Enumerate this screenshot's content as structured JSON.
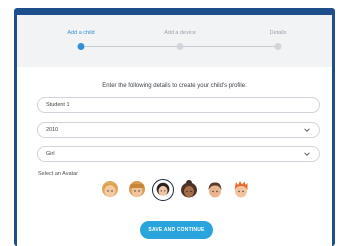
{
  "steps": [
    {
      "label": "Add a child",
      "active": true
    },
    {
      "label": "Add a device",
      "active": false
    },
    {
      "label": "Details",
      "active": false
    }
  ],
  "heading": "Enter the following details to create your child's profile:",
  "fields": {
    "name": {
      "value": "Student 1"
    },
    "birth_year": {
      "value": "2010"
    },
    "gender": {
      "value": "Girl"
    }
  },
  "avatar_label": "Select an Avatar",
  "avatars": [
    {
      "name": "blonde-girl",
      "selected": false
    },
    {
      "name": "bob-girl",
      "selected": false
    },
    {
      "name": "dark-hair-girl",
      "selected": true
    },
    {
      "name": "curly-hair-girl",
      "selected": false
    },
    {
      "name": "brown-hair-boy",
      "selected": false
    },
    {
      "name": "red-hair-boy",
      "selected": false
    }
  ],
  "button": {
    "label": "SAVE AND CONTINUE"
  },
  "colors": {
    "accent": "#2aa4dc",
    "frame": "#1f4e8c",
    "active_step": "#2f8fd8"
  }
}
